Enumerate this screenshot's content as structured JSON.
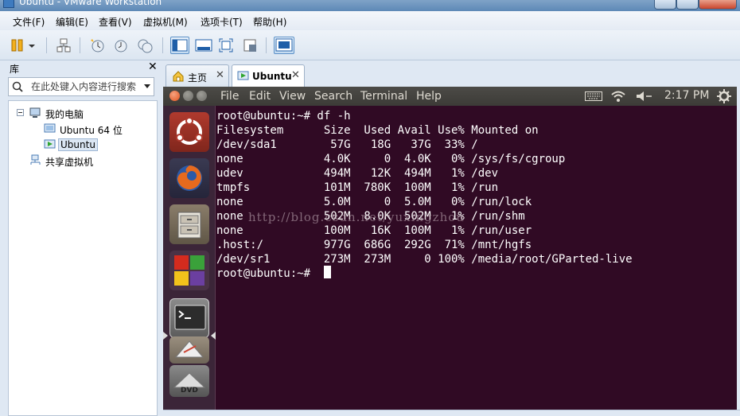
{
  "window": {
    "title": "Ubuntu - VMware Workstation"
  },
  "menubar": {
    "items": [
      "文件(F)",
      "编辑(E)",
      "查看(V)",
      "虚拟机(M)",
      "选项卡(T)",
      "帮助(H)"
    ]
  },
  "toolbar": {
    "icons": [
      "pause-icon",
      "network-icon",
      "snapshot-icon",
      "revert-icon",
      "manage-snapshots-icon",
      "sidebar-icon",
      "thumbnail-icon",
      "fullscreen-icon",
      "unity-icon",
      "console-view-icon"
    ]
  },
  "library": {
    "title": "库",
    "close": "✕",
    "search_placeholder": "在此处键入内容进行搜索",
    "tree": {
      "my_computer": "我的电脑",
      "vm1": "Ubuntu 64 位",
      "vm2": "Ubuntu",
      "shared": "共享虚拟机"
    }
  },
  "tabs": [
    {
      "label": "主页",
      "close": "✕"
    },
    {
      "label": "Ubuntu",
      "close": "✕"
    }
  ],
  "guest": {
    "menu": [
      "File",
      "Edit",
      "View",
      "Search",
      "Terminal",
      "Help"
    ],
    "clock": "2:17 PM",
    "launcher": [
      "ubuntu-logo-icon",
      "firefox-icon",
      "file-manager-icon",
      "office-icon",
      "terminal-icon",
      "text-editor-icon",
      "dvd-icon"
    ]
  },
  "terminal": {
    "lines": [
      "root@ubuntu:~# df -h",
      "Filesystem      Size  Used Avail Use% Mounted on",
      "/dev/sda1        57G   18G   37G  33% /",
      "none            4.0K     0  4.0K   0% /sys/fs/cgroup",
      "udev            494M   12K  494M   1% /dev",
      "tmpfs           101M  780K  100M   1% /run",
      "none            5.0M     0  5.0M   0% /run/lock",
      "none            502M  8.0K  502M   1% /run/shm",
      "none            100M   16K  100M   1% /run/user",
      ".host:/         977G  686G  292G  71% /mnt/hgfs",
      "/dev/sr1        273M  273M     0 100% /media/root/GParted-live",
      "root@ubuntu:~# "
    ],
    "watermark": "http://blog.csdn.net/yuxingzhou"
  },
  "colors": {
    "terminal_bg": "#300a24",
    "ubuntu_orange": "#dd4814",
    "vmware_blue": "#5d88b6"
  }
}
